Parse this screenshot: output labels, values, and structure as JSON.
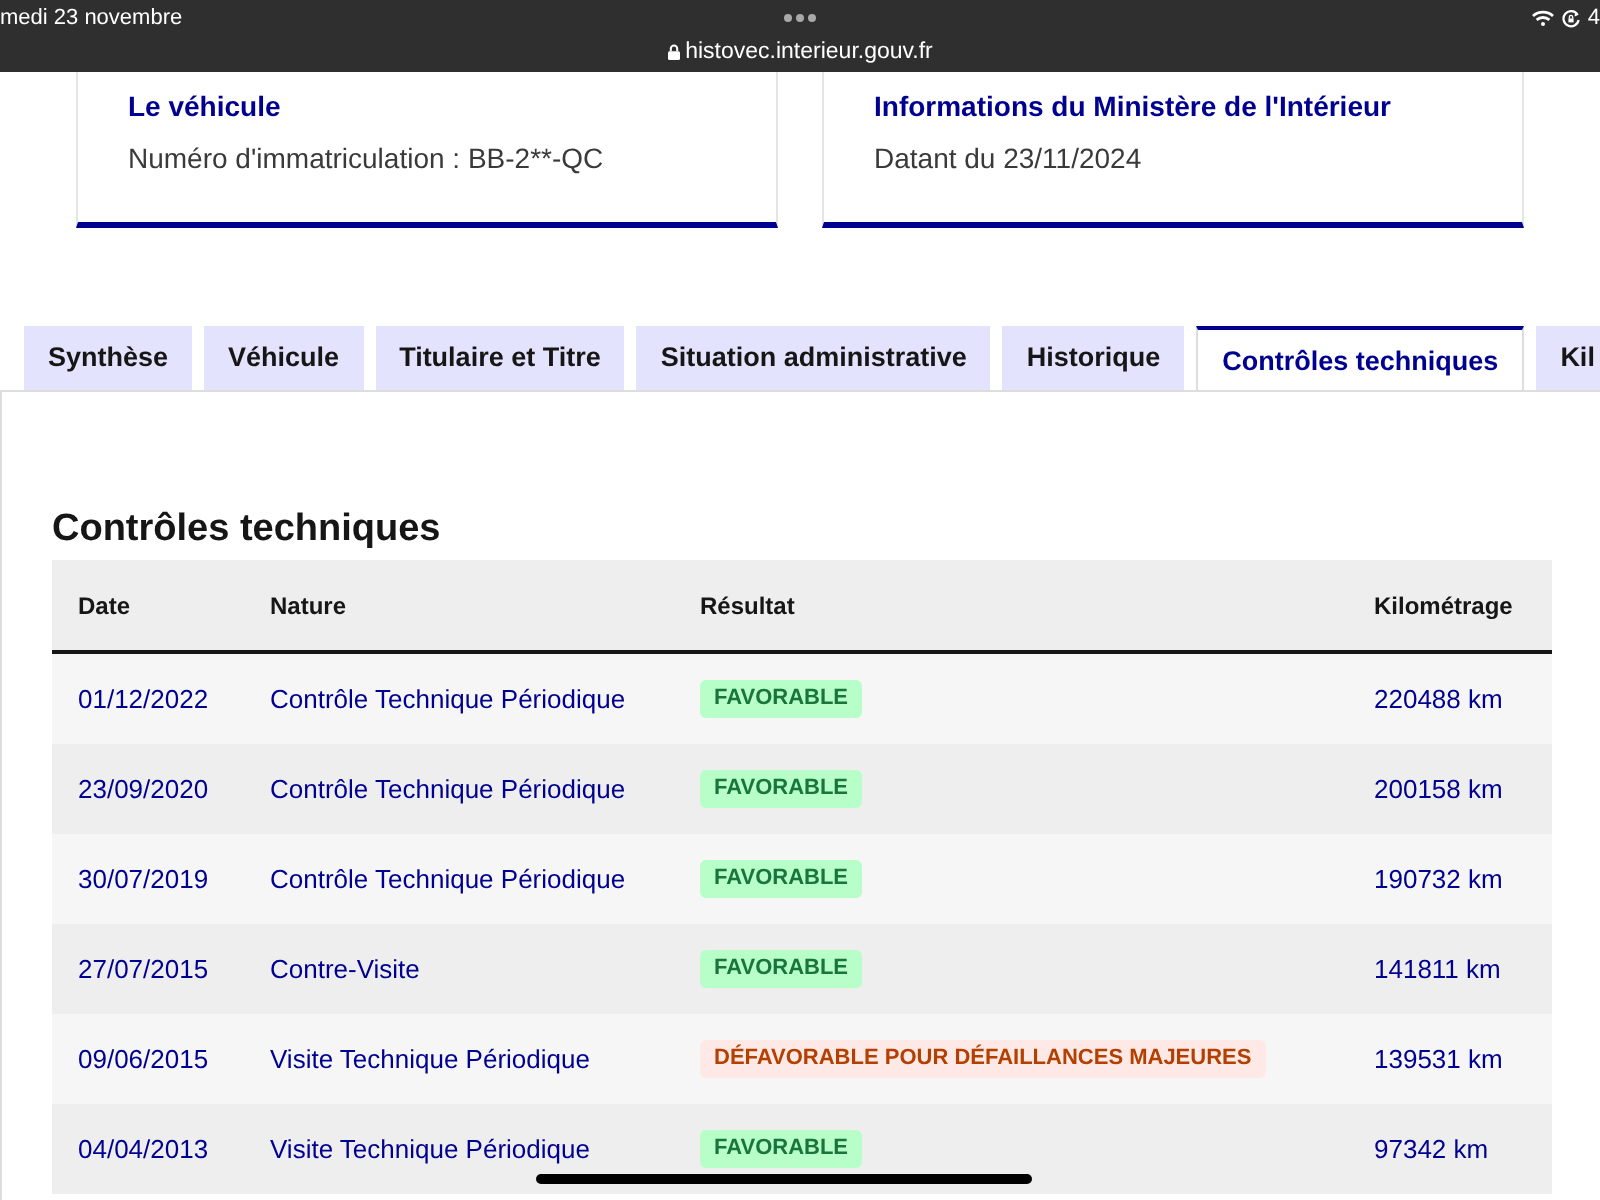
{
  "status_bar": {
    "date": "medi 23 novembre",
    "url": "histovec.interieur.gouv.fr",
    "battery_text": "4"
  },
  "cards": [
    {
      "title": "Le véhicule",
      "text": "Numéro d'immatriculation : BB-2**-QC"
    },
    {
      "title": "Informations du Ministère de l'Intérieur",
      "text": "Datant du 23/11/2024"
    }
  ],
  "tabs": [
    {
      "label": "Synthèse",
      "selected": false
    },
    {
      "label": "Véhicule",
      "selected": false
    },
    {
      "label": "Titulaire et Titre",
      "selected": false
    },
    {
      "label": "Situation administrative",
      "selected": false
    },
    {
      "label": "Historique",
      "selected": false
    },
    {
      "label": "Contrôles techniques",
      "selected": true
    },
    {
      "label": "Kil",
      "selected": false
    }
  ],
  "section_title": "Contrôles techniques",
  "table": {
    "columns": [
      "Date",
      "Nature",
      "Résultat",
      "Kilométrage"
    ],
    "rows": [
      {
        "date": "01/12/2022",
        "nature": "Contrôle Technique Périodique",
        "result": {
          "text": "FAVORABLE",
          "kind": "favorable"
        },
        "mileage": "220488 km"
      },
      {
        "date": "23/09/2020",
        "nature": "Contrôle Technique Périodique",
        "result": {
          "text": "FAVORABLE",
          "kind": "favorable"
        },
        "mileage": "200158 km"
      },
      {
        "date": "30/07/2019",
        "nature": "Contrôle Technique Périodique",
        "result": {
          "text": "FAVORABLE",
          "kind": "favorable"
        },
        "mileage": "190732 km"
      },
      {
        "date": "27/07/2015",
        "nature": "Contre-Visite",
        "result": {
          "text": "FAVORABLE",
          "kind": "favorable"
        },
        "mileage": "141811 km"
      },
      {
        "date": "09/06/2015",
        "nature": "Visite Technique Périodique",
        "result": {
          "text": "DÉFAVORABLE POUR DÉFAILLANCES MAJEURES",
          "kind": "unfavorable"
        },
        "mileage": "139531 km"
      },
      {
        "date": "04/04/2013",
        "nature": "Visite Technique Périodique",
        "result": {
          "text": "FAVORABLE",
          "kind": "favorable"
        },
        "mileage": "97342 km"
      }
    ]
  }
}
